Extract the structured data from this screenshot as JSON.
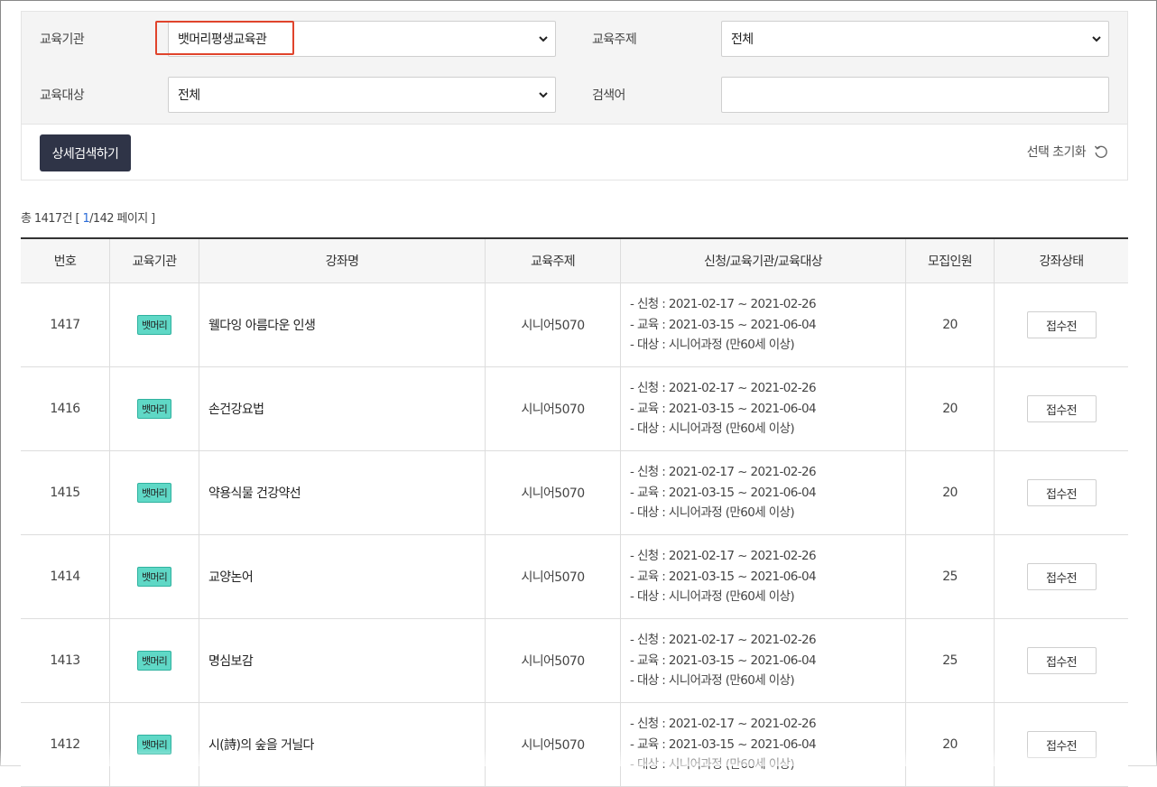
{
  "filters": {
    "institution": {
      "label": "교육기관",
      "value": "뱃머리평생교육관"
    },
    "topic": {
      "label": "교육주제",
      "value": "전체"
    },
    "target": {
      "label": "교육대상",
      "value": "전체"
    },
    "keyword": {
      "label": "검색어",
      "value": ""
    },
    "search_button": "상세검색하기",
    "reset_label": "선택 초기화"
  },
  "summary": {
    "prefix": "총 1417건 [ ",
    "current_page": "1",
    "suffix": "/142 페이지 ]"
  },
  "table": {
    "headers": [
      "번호",
      "교육기관",
      "강좌명",
      "교육주제",
      "신청/교육기관/교육대상",
      "모집인원",
      "강좌상태"
    ],
    "rows": [
      {
        "no": "1417",
        "org": "뱃머리",
        "title": "웰다잉 아름다운 인생",
        "topic": "시니어5070",
        "apply": "- 신청 : 2021-02-17 ~ 2021-02-26",
        "edu": "- 교육 : 2021-03-15 ~ 2021-06-04",
        "target": "- 대상 : 시니어과정 (만60세 이상)",
        "capacity": "20",
        "status": "접수전"
      },
      {
        "no": "1416",
        "org": "뱃머리",
        "title": "손건강요법",
        "topic": "시니어5070",
        "apply": "- 신청 : 2021-02-17 ~ 2021-02-26",
        "edu": "- 교육 : 2021-03-15 ~ 2021-06-04",
        "target": "- 대상 : 시니어과정 (만60세 이상)",
        "capacity": "20",
        "status": "접수전"
      },
      {
        "no": "1415",
        "org": "뱃머리",
        "title": "약용식물 건강약선",
        "topic": "시니어5070",
        "apply": "- 신청 : 2021-02-17 ~ 2021-02-26",
        "edu": "- 교육 : 2021-03-15 ~ 2021-06-04",
        "target": "- 대상 : 시니어과정 (만60세 이상)",
        "capacity": "20",
        "status": "접수전"
      },
      {
        "no": "1414",
        "org": "뱃머리",
        "title": "교양논어",
        "topic": "시니어5070",
        "apply": "- 신청 : 2021-02-17 ~ 2021-02-26",
        "edu": "- 교육 : 2021-03-15 ~ 2021-06-04",
        "target": "- 대상 : 시니어과정 (만60세 이상)",
        "capacity": "25",
        "status": "접수전"
      },
      {
        "no": "1413",
        "org": "뱃머리",
        "title": "명심보감",
        "topic": "시니어5070",
        "apply": "- 신청 : 2021-02-17 ~ 2021-02-26",
        "edu": "- 교육 : 2021-03-15 ~ 2021-06-04",
        "target": "- 대상 : 시니어과정 (만60세 이상)",
        "capacity": "25",
        "status": "접수전"
      },
      {
        "no": "1412",
        "org": "뱃머리",
        "title": "시(詩)의 숲을 거닐다",
        "topic": "시니어5070",
        "apply": "- 신청 : 2021-02-17 ~ 2021-02-26",
        "edu": "- 교육 : 2021-03-15 ~ 2021-06-04",
        "target": "- 대상 : 시니어과정 (만60세 이상)",
        "capacity": "20",
        "status": "접수전"
      }
    ]
  },
  "colors": {
    "search_button_bg": "#2f3447",
    "badge_bg": "#5fd8c6",
    "highlight_border": "#e0442c",
    "page_link": "#2b6cd8"
  }
}
